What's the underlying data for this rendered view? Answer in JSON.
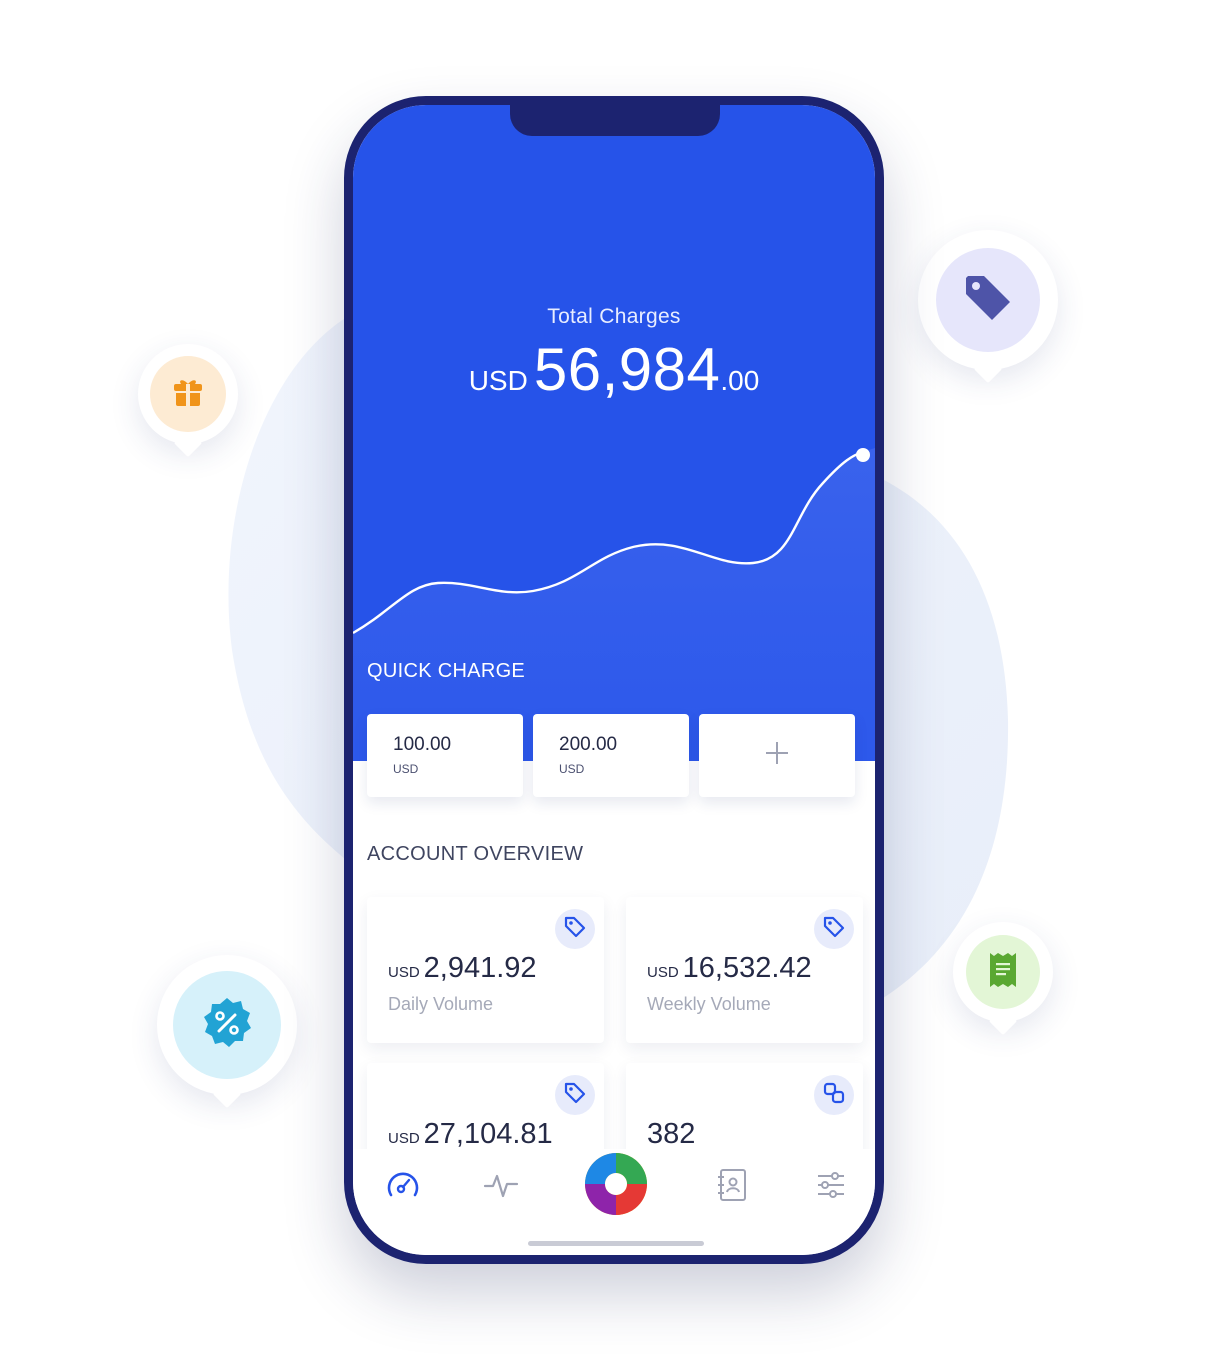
{
  "hero": {
    "total_label": "Total Charges",
    "currency": "USD",
    "amount_whole": "56,984",
    "amount_decimal": ".00"
  },
  "quick_charge": {
    "title": "QUICK CHARGE",
    "cards": [
      {
        "amount": "100.00",
        "currency": "USD"
      },
      {
        "amount": "200.00",
        "currency": "USD"
      }
    ],
    "add_icon": "plus-icon"
  },
  "account_overview": {
    "title": "ACCOUNT OVERVIEW",
    "cards": [
      {
        "currency": "USD",
        "value": "2,941.92",
        "label": "Daily Volume",
        "icon": "tag-icon"
      },
      {
        "currency": "USD",
        "value": "16,532.42",
        "label": "Weekly Volume",
        "icon": "tag-icon"
      },
      {
        "currency": "USD",
        "value": "27,104.81",
        "label": "",
        "icon": "tag-icon"
      },
      {
        "currency": "",
        "value": "382",
        "label": "",
        "icon": "link-icon"
      }
    ]
  },
  "tabbar": {
    "items": [
      "dashboard-icon",
      "activity-icon",
      "app-logo",
      "contacts-icon",
      "settings-sliders-icon"
    ]
  },
  "floating_badges": [
    "gift-icon",
    "tag-icon",
    "percent-badge-icon",
    "receipt-icon"
  ],
  "colors": {
    "primary": "#2653e9",
    "phone_frame": "#1c2370",
    "text_dark": "#252a46",
    "text_muted": "#a5a9b8",
    "gift_bg": "#fdebd3",
    "tag_bg": "#e6e6fb",
    "percent_bg": "#d6f1fa",
    "receipt_bg": "#e3f6d6"
  }
}
